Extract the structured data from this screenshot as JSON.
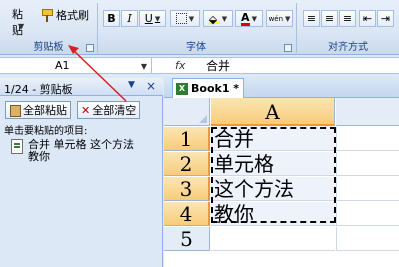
{
  "ribbon": {
    "clipboard": {
      "paste_label": "粘贴",
      "format_painter_label": "格式刷",
      "group_label": "剪贴板"
    },
    "font": {
      "bold": "B",
      "italic": "I",
      "underline": "U",
      "font_color": "A",
      "phonetic": "wén",
      "group_label": "字体"
    },
    "alignment": {
      "group_label": "对齐方式"
    }
  },
  "formula_bar": {
    "name_box": "A1",
    "fx": "fx",
    "value": "合并"
  },
  "clipboard_pane": {
    "title": "1/24 - 剪贴板",
    "paste_all": "全部粘贴",
    "clear_all": "全部清空",
    "hint": "单击要粘贴的项目:",
    "item_line1": "合并  单元格  这个方法",
    "item_line2": "教你"
  },
  "workbook": {
    "tab_title": "Book1 *",
    "column_header": "A",
    "rows": [
      {
        "num": "1",
        "value": "合并"
      },
      {
        "num": "2",
        "value": "单元格"
      },
      {
        "num": "3",
        "value": "这个方法"
      },
      {
        "num": "4",
        "value": "教你"
      },
      {
        "num": "5",
        "value": ""
      }
    ]
  },
  "colors": {
    "annotation_arrow": "#d62020",
    "selected_header": "#f8cc7a",
    "ribbon_bg": "#dbe6f4"
  }
}
